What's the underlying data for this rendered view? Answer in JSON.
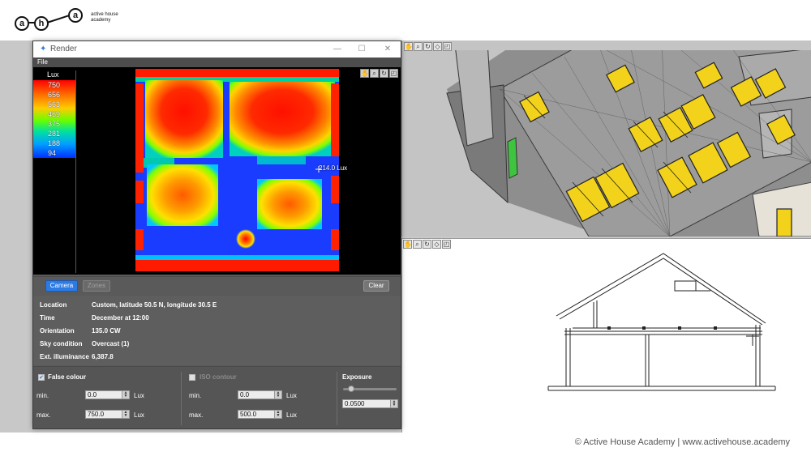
{
  "header": {
    "logo_letters": [
      "a",
      "h",
      "a"
    ],
    "logo_text_line1": "active house",
    "logo_text_line2": "academy"
  },
  "render_window": {
    "title": "Render",
    "controls": {
      "minimize": "—",
      "maximize": "☐",
      "close": "✕"
    },
    "menu": {
      "file": "File"
    },
    "legend": {
      "title": "Lux",
      "values": [
        "750",
        "656",
        "563",
        "469",
        "375",
        "281",
        "188",
        "94"
      ]
    },
    "probe_label": "214.0 Lux",
    "buttons": {
      "camera": "Camera",
      "zones": "Zones",
      "clear": "Clear"
    },
    "info": [
      {
        "key": "Location",
        "value": "Custom, latitude 50.5 N, longitude 30.5 E"
      },
      {
        "key": "Time",
        "value": "December at 12:00"
      },
      {
        "key": "Orientation",
        "value": "135.0 CW"
      },
      {
        "key": "Sky condition",
        "value": "Overcast (1)"
      },
      {
        "key": "Ext. illuminance",
        "value": "6,387.8"
      }
    ],
    "false_colour": {
      "label": "False colour",
      "checked": true,
      "min_label": "min.",
      "min_value": "0.0",
      "max_label": "max.",
      "max_value": "750.0",
      "unit": "Lux"
    },
    "iso_contour": {
      "label": "ISO contour",
      "checked": false,
      "min_label": "min.",
      "min_value": "0.0",
      "max_label": "max.",
      "max_value": "500.0",
      "unit": "Lux"
    },
    "exposure": {
      "label": "Exposure",
      "value": "0.0500",
      "slider_fraction": 0.1
    }
  },
  "views": {
    "toolbar_icons": [
      "hand-icon",
      "zoom-icon",
      "orbit-icon",
      "cube-icon",
      "fit-icon"
    ]
  },
  "footer": {
    "text": "© Active House Academy | www.activehouse.academy"
  },
  "colors": {
    "accent_blue": "#2c7be5",
    "window_bg": "#5a5a5a",
    "roof_window_yellow": "#f2d21a"
  }
}
